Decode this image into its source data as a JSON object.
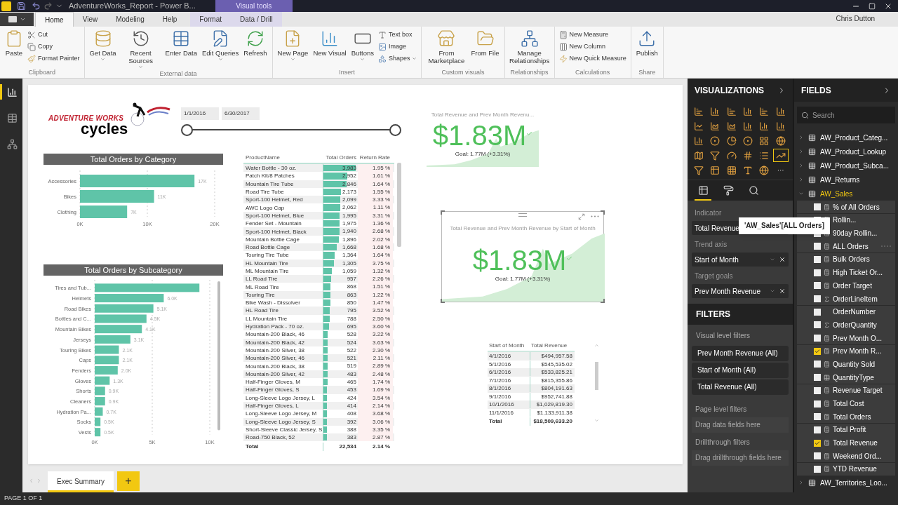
{
  "title_bar": {
    "title": "AdventureWorks_Report - Power B...",
    "context_label": "Visual tools"
  },
  "ribbon_tabs": [
    {
      "label": "Home",
      "selected": true,
      "kind": "standard"
    },
    {
      "label": "View",
      "selected": false,
      "kind": "standard"
    },
    {
      "label": "Modeling",
      "selected": false,
      "kind": "standard"
    },
    {
      "label": "Help",
      "selected": false,
      "kind": "standard"
    },
    {
      "label": "Format",
      "selected": false,
      "kind": "contextual"
    },
    {
      "label": "Data / Drill",
      "selected": false,
      "kind": "contextual"
    }
  ],
  "user": "Chris Dutton",
  "ribbon_groups": [
    {
      "name": "Clipboard",
      "buttons": [
        {
          "label": "Paste",
          "kind": "large",
          "dropdown": false
        },
        {
          "label": "Cut",
          "kind": "small",
          "dropdown": false
        },
        {
          "label": "Copy",
          "kind": "small",
          "dropdown": false
        },
        {
          "label": "Format Painter",
          "kind": "small",
          "dropdown": false
        }
      ]
    },
    {
      "name": "External data",
      "buttons": [
        {
          "label": "Get Data",
          "kind": "large",
          "dropdown": true
        },
        {
          "label": "Recent Sources",
          "kind": "large",
          "dropdown": true
        },
        {
          "label": "Enter Data",
          "kind": "large",
          "dropdown": false
        },
        {
          "label": "Edit Queries",
          "kind": "large",
          "dropdown": true
        },
        {
          "label": "Refresh",
          "kind": "large",
          "dropdown": false
        }
      ]
    },
    {
      "name": "Insert",
      "buttons": [
        {
          "label": "New Page",
          "kind": "large",
          "dropdown": true
        },
        {
          "label": "New Visual",
          "kind": "large",
          "dropdown": false
        },
        {
          "label": "Buttons",
          "kind": "large",
          "dropdown": true
        },
        {
          "label": "Text box",
          "kind": "small",
          "dropdown": false
        },
        {
          "label": "Image",
          "kind": "small",
          "dropdown": false
        },
        {
          "label": "Shapes",
          "kind": "small",
          "dropdown": true
        }
      ]
    },
    {
      "name": "Custom visuals",
      "buttons": [
        {
          "label": "From Marketplace",
          "kind": "large",
          "dropdown": false
        },
        {
          "label": "From File",
          "kind": "large",
          "dropdown": false
        }
      ]
    },
    {
      "name": "Relationships",
      "buttons": [
        {
          "label": "Manage Relationships",
          "kind": "large",
          "dropdown": false
        }
      ]
    },
    {
      "name": "Calculations",
      "buttons": [
        {
          "label": "New Measure",
          "kind": "small",
          "dropdown": false
        },
        {
          "label": "New Column",
          "kind": "small",
          "dropdown": false
        },
        {
          "label": "New Quick Measure",
          "kind": "small",
          "dropdown": false
        }
      ]
    },
    {
      "name": "Share",
      "buttons": [
        {
          "label": "Publish",
          "kind": "large",
          "dropdown": false
        }
      ]
    }
  ],
  "nav_views": [
    {
      "selected": true
    },
    {
      "selected": false
    },
    {
      "selected": false
    }
  ],
  "report": {
    "logo": {
      "line1": "ADVENTURE WORKS",
      "line2": "cycles"
    },
    "date_slicer": {
      "start": "1/1/2016",
      "end": "6/30/2017",
      "start_handle": {
        "level": 0
      },
      "end_handle": {
        "level": 1
      }
    },
    "category_chart": {
      "chart_data": {
        "type": "bar",
        "orientation": "horizontal",
        "title": "Total Orders by Category",
        "categories": [
          "Accessories",
          "Bikes",
          "Clothing"
        ],
        "values": [
          17000,
          11000,
          7000
        ],
        "xlim": [
          0,
          20000
        ],
        "xticks": [
          {
            "value": 0,
            "label": "0K"
          },
          {
            "value": 10000,
            "label": "10K"
          },
          {
            "value": 20000,
            "label": "20K"
          }
        ],
        "value_labels": [
          "17K",
          "11K",
          "7K"
        ]
      }
    },
    "subcategory_chart": {
      "chart_data": {
        "type": "bar",
        "orientation": "horizontal",
        "title": "Total Orders by Subcategory",
        "categories": [
          "Tires and Tub...",
          "Helmets",
          "Road Bikes",
          "Bottles and C...",
          "Mountain Bikes",
          "Jerseys",
          "Touring Bikes",
          "Caps",
          "Fenders",
          "Gloves",
          "Shorts",
          "Cleaners",
          "Hydration Pa...",
          "Socks",
          "Vests"
        ],
        "values": [
          9100,
          6000,
          5100,
          4500,
          4100,
          3100,
          2100,
          2100,
          2000,
          1300,
          900,
          900,
          700,
          500,
          500
        ],
        "xlim": [
          0,
          10000
        ],
        "xticks": [
          {
            "value": 0,
            "label": "0K"
          },
          {
            "value": 5000,
            "label": "5K"
          },
          {
            "value": 10000,
            "label": "10K"
          }
        ],
        "value_labels": [
          null,
          "6.0K",
          "5.1K",
          "4.5K",
          "4.1K",
          "3.1K",
          "2.1K",
          "2.1K",
          "2.0K",
          "1.3K",
          "0.9K",
          "0.9K",
          "0.7K",
          "0.5K",
          "0.5K"
        ]
      }
    },
    "product_table": {
      "columns": [
        "ProductName",
        "Total Orders",
        "Return Rate"
      ],
      "rows": [
        {
          "name": "Water Bottle - 30 oz.",
          "orders": "3,983",
          "level": 1.0,
          "rate": "1.95 %"
        },
        {
          "name": "Patch Kit/8 Patches",
          "orders": "2,952",
          "level": 0.74,
          "rate": "1.61 %"
        },
        {
          "name": "Mountain Tire Tube",
          "orders": "2,846",
          "level": 0.71,
          "rate": "1.64 %"
        },
        {
          "name": "Road Tire Tube",
          "orders": "2,173",
          "level": 0.55,
          "rate": "1.55 %"
        },
        {
          "name": "Sport-100 Helmet, Red",
          "orders": "2,099",
          "level": 0.53,
          "rate": "3.33 %"
        },
        {
          "name": "AWC Logo Cap",
          "orders": "2,062",
          "level": 0.52,
          "rate": "1.11 %"
        },
        {
          "name": "Sport-100 Helmet, Blue",
          "orders": "1,995",
          "level": 0.5,
          "rate": "3.31 %"
        },
        {
          "name": "Fender Set - Mountain",
          "orders": "1,975",
          "level": 0.5,
          "rate": "1.36 %"
        },
        {
          "name": "Sport-100 Helmet, Black",
          "orders": "1,940",
          "level": 0.49,
          "rate": "2.68 %"
        },
        {
          "name": "Mountain Bottle Cage",
          "orders": "1,896",
          "level": 0.48,
          "rate": "2.02 %"
        },
        {
          "name": "Road Bottle Cage",
          "orders": "1,668",
          "level": 0.42,
          "rate": "1.68 %"
        },
        {
          "name": "Touring Tire Tube",
          "orders": "1,364",
          "level": 0.34,
          "rate": "1.64 %"
        },
        {
          "name": "HL Mountain Tire",
          "orders": "1,305",
          "level": 0.33,
          "rate": "3.75 %"
        },
        {
          "name": "ML Mountain Tire",
          "orders": "1,059",
          "level": 0.27,
          "rate": "1.32 %"
        },
        {
          "name": "LL Road Tire",
          "orders": "957",
          "level": 0.24,
          "rate": "2.26 %"
        },
        {
          "name": "ML Road Tire",
          "orders": "868",
          "level": 0.22,
          "rate": "1.51 %"
        },
        {
          "name": "Touring Tire",
          "orders": "863",
          "level": 0.22,
          "rate": "1.22 %"
        },
        {
          "name": "Bike Wash - Dissolver",
          "orders": "850",
          "level": 0.21,
          "rate": "1.47 %"
        },
        {
          "name": "HL Road Tire",
          "orders": "795",
          "level": 0.2,
          "rate": "3.52 %"
        },
        {
          "name": "LL Mountain Tire",
          "orders": "788",
          "level": 0.2,
          "rate": "2.50 %"
        },
        {
          "name": "Hydration Pack - 70 oz.",
          "orders": "695",
          "level": 0.17,
          "rate": "3.60 %"
        },
        {
          "name": "Mountain-200 Black, 46",
          "orders": "528",
          "level": 0.13,
          "rate": "3.22 %"
        },
        {
          "name": "Mountain-200 Black, 42",
          "orders": "524",
          "level": 0.13,
          "rate": "3.63 %"
        },
        {
          "name": "Mountain-200 Silver, 38",
          "orders": "522",
          "level": 0.13,
          "rate": "2.30 %"
        },
        {
          "name": "Mountain-200 Silver, 46",
          "orders": "521",
          "level": 0.13,
          "rate": "2.11 %"
        },
        {
          "name": "Mountain-200 Black, 38",
          "orders": "519",
          "level": 0.13,
          "rate": "2.89 %"
        },
        {
          "name": "Mountain-200 Silver, 42",
          "orders": "483",
          "level": 0.12,
          "rate": "2.48 %"
        },
        {
          "name": "Half-Finger Gloves, M",
          "orders": "465",
          "level": 0.12,
          "rate": "1.74 %"
        },
        {
          "name": "Half-Finger Gloves, S",
          "orders": "453",
          "level": 0.11,
          "rate": "1.69 %"
        },
        {
          "name": "Long-Sleeve Logo Jersey, L",
          "orders": "424",
          "level": 0.11,
          "rate": "3.54 %"
        },
        {
          "name": "Half-Finger Gloves, L",
          "orders": "414",
          "level": 0.1,
          "rate": "2.14 %"
        },
        {
          "name": "Long-Sleeve Logo Jersey, M",
          "orders": "408",
          "level": 0.1,
          "rate": "3.68 %"
        },
        {
          "name": "Long-Sleeve Logo Jersey, S",
          "orders": "392",
          "level": 0.1,
          "rate": "3.06 %"
        },
        {
          "name": "Short-Sleeve Classic Jersey, S",
          "orders": "388",
          "level": 0.1,
          "rate": "3.35 %"
        },
        {
          "name": "Road-750 Black, 52",
          "orders": "383",
          "level": 0.1,
          "rate": "2.87 %"
        }
      ],
      "total": {
        "label": "Total",
        "orders": "22,534",
        "rate": "2.14 %"
      }
    },
    "kpi_cards": [
      {
        "title": "Total Revenue and Prev Month Revenu...",
        "value": "$1.83M",
        "goal": "Goal: 1.77M (+3.31%)",
        "selected": false
      },
      {
        "title": "Total Revenue and Prev Month Revenue by Start of Month",
        "value": "$1.83M",
        "goal": "Goal: 1.77M (+3.31%)",
        "selected": true
      }
    ],
    "revenue_table": {
      "columns": [
        "Start of Month",
        "Total Revenue"
      ],
      "rows": [
        {
          "month": "4/1/2016",
          "revenue": "$494,957.58"
        },
        {
          "month": "5/1/2016",
          "revenue": "$545,535.02"
        },
        {
          "month": "6/1/2016",
          "revenue": "$533,825.21"
        },
        {
          "month": "7/1/2016",
          "revenue": "$815,355.86"
        },
        {
          "month": "8/1/2016",
          "revenue": "$804,191.63"
        },
        {
          "month": "9/1/2016",
          "revenue": "$952,741.88"
        },
        {
          "month": "10/1/2016",
          "revenue": "$1,029,819.30"
        },
        {
          "month": "11/1/2016",
          "revenue": "$1,133,911.38"
        }
      ],
      "total": {
        "label": "Total",
        "revenue": "$18,509,633.20"
      }
    }
  },
  "pages": [
    {
      "label": "Exec Summary",
      "selected": true
    }
  ],
  "add_page": "+",
  "status": "PAGE 1 OF 1",
  "visualizations": {
    "title": "VISUALIZATIONS",
    "types": [
      {
        "selected": false
      },
      {
        "selected": false
      },
      {
        "selected": false
      },
      {
        "selected": false
      },
      {
        "selected": false
      },
      {
        "selected": false
      },
      {
        "selected": false
      },
      {
        "selected": false
      },
      {
        "selected": false
      },
      {
        "selected": false
      },
      {
        "selected": false
      },
      {
        "selected": false
      },
      {
        "selected": false
      },
      {
        "selected": false
      },
      {
        "selected": false
      },
      {
        "selected": false
      },
      {
        "selected": false
      },
      {
        "selected": false
      },
      {
        "selected": false
      },
      {
        "selected": false
      },
      {
        "selected": false
      },
      {
        "selected": false
      },
      {
        "selected": false
      },
      {
        "selected": true
      },
      {
        "selected": false
      },
      {
        "selected": false
      },
      {
        "selected": false
      },
      {
        "selected": false
      },
      {
        "selected": false
      }
    ],
    "more": "···",
    "panes": [
      {
        "selected": true
      },
      {
        "selected": false
      },
      {
        "selected": false
      }
    ],
    "wells": [
      {
        "label": "Indicator",
        "field": "Total Revenue"
      },
      {
        "label": "Trend axis",
        "field": "Start of Month",
        "removable": true
      },
      {
        "label": "Target goals",
        "field": "Prev Month Revenue",
        "removable": true
      }
    ]
  },
  "filters": {
    "title": "FILTERS",
    "visual_label": "Visual level filters",
    "visual_filters": [
      "Prev Month Revenue (All)",
      "Start of Month (All)",
      "Total Revenue (All)"
    ],
    "page_label": "Page level filters",
    "page_drop": "Drag data fields here",
    "drill_label": "Drillthrough filters",
    "drill_drop": "Drag drillthrough fields here"
  },
  "fields": {
    "title": "FIELDS",
    "search": {
      "placeholder": "Search"
    },
    "tooltip": "'AW_Sales'[ALL Orders]",
    "tables": [
      {
        "name": "AW_Product_Categ...",
        "expanded": false,
        "selected": false
      },
      {
        "name": "AW_Product_Lookup",
        "expanded": false,
        "selected": false
      },
      {
        "name": "AW_Product_Subca...",
        "expanded": false,
        "selected": false
      },
      {
        "name": "AW_Returns",
        "expanded": false,
        "selected": false
      },
      {
        "name": "AW_Sales",
        "expanded": true,
        "selected": true,
        "children": [
          {
            "name": "% of All Orders",
            "kind": "measure",
            "checked": false,
            "hovered": false
          },
          {
            "name": "Rollin...",
            "kind": "measure",
            "checked": false,
            "hovered": false
          },
          {
            "name": "90day Rollin...",
            "kind": "measure",
            "checked": false,
            "hovered": false
          },
          {
            "name": "ALL Orders",
            "kind": "measure",
            "checked": false,
            "hovered": true
          },
          {
            "name": "Bulk Orders",
            "kind": "measure",
            "checked": false,
            "hovered": false
          },
          {
            "name": "High Ticket Or...",
            "kind": "measure",
            "checked": false,
            "hovered": false
          },
          {
            "name": "Order Target",
            "kind": "measure",
            "checked": false,
            "hovered": false
          },
          {
            "name": "OrderLineItem",
            "kind": "sum",
            "checked": false,
            "hovered": false
          },
          {
            "name": "OrderNumber",
            "kind": "plain",
            "checked": false,
            "hovered": false
          },
          {
            "name": "OrderQuantity",
            "kind": "sum",
            "checked": false,
            "hovered": false
          },
          {
            "name": "Prev Month O...",
            "kind": "measure",
            "checked": false,
            "hovered": false
          },
          {
            "name": "Prev Month R...",
            "kind": "measure",
            "checked": true,
            "hovered": false
          },
          {
            "name": "Quantity Sold",
            "kind": "measure",
            "checked": false,
            "hovered": false
          },
          {
            "name": "QuantityType",
            "kind": "calculated",
            "checked": false,
            "hovered": false
          },
          {
            "name": "Revenue Target",
            "kind": "measure",
            "checked": false,
            "hovered": false
          },
          {
            "name": "Total Cost",
            "kind": "measure",
            "checked": false,
            "hovered": false
          },
          {
            "name": "Total Orders",
            "kind": "measure",
            "checked": false,
            "hovered": false
          },
          {
            "name": "Total Profit",
            "kind": "measure",
            "checked": false,
            "hovered": false
          },
          {
            "name": "Total Revenue",
            "kind": "measure",
            "checked": true,
            "hovered": false
          },
          {
            "name": "Weekend Ord...",
            "kind": "measure",
            "checked": false,
            "hovered": false
          },
          {
            "name": "YTD Revenue",
            "kind": "measure",
            "checked": false,
            "hovered": false
          }
        ]
      },
      {
        "name": "AW_Territories_Loo...",
        "expanded": false,
        "selected": false
      }
    ]
  }
}
